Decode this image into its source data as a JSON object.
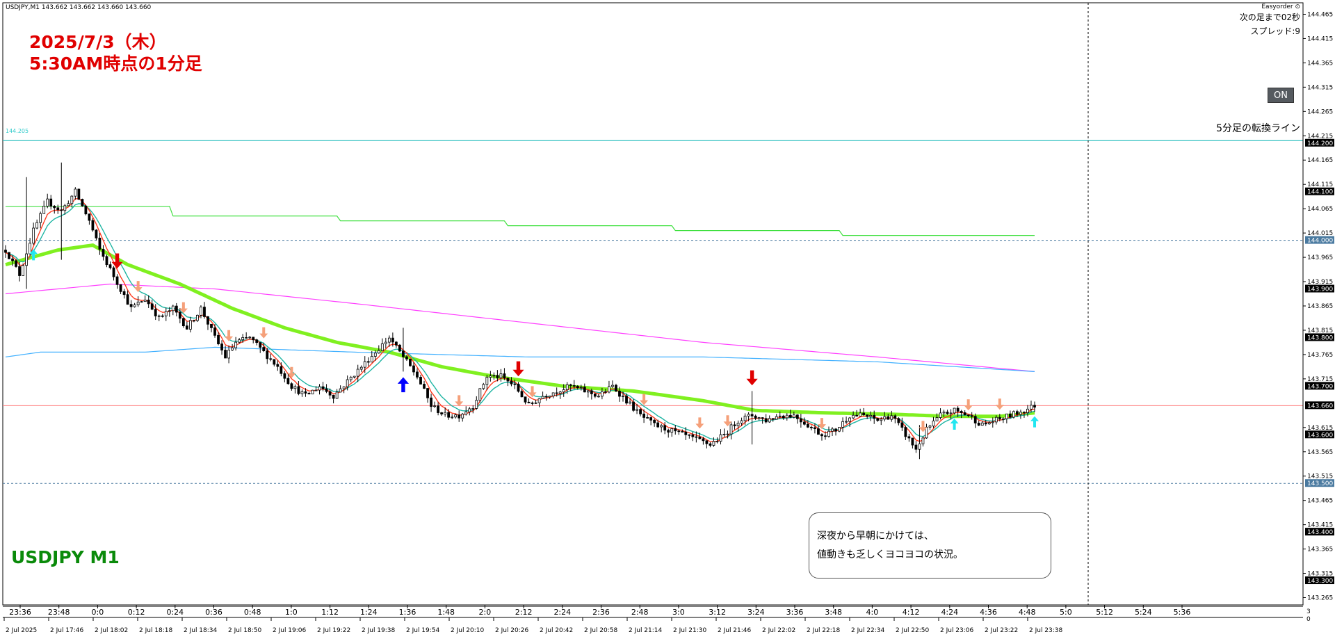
{
  "header": {
    "symbol_info": "USDJPY,M1  143.662 143.662 143.660 143.660"
  },
  "annotation": {
    "line1": "2025/7/3（木）",
    "line2": "5:30AM時点の1分足"
  },
  "corner_label": "USDJPY M1",
  "info_panel": {
    "indicator_name": "Easyorder ⊙",
    "next_bar": "次の足まで02秒",
    "spread": "スプレッド:9"
  },
  "on_button": "ON",
  "callout": {
    "line1": "深夜から早朝にかけては、",
    "line2": "値動きも乏しくヨコヨコの状況。"
  },
  "turn_line": {
    "label": "5分足の転換ライン",
    "price_label": "144.205"
  },
  "colors": {
    "background": "#ffffff",
    "candle": "#000000",
    "ema_fast": "#ff3b1f",
    "ema_mid": "#1fb5a3",
    "ema_thick": "#80f020",
    "ma_green_thin": "#40e040",
    "ma_magenta": "#ff40ff",
    "ma_lightblue": "#40b0ff",
    "bid_line": "#ff8080",
    "turn_line": "#30c0c0",
    "dotted_level": "#4a7aa0",
    "arrow_salmon": "#f5a07a",
    "arrow_red": "#e00000",
    "arrow_blue": "#0000ff",
    "arrow_cyan": "#22e6f0"
  },
  "chart_data": {
    "type": "candlestick",
    "title": "USDJPY,M1",
    "ylim": [
      143.26,
      144.48
    ],
    "y_ticks": [
      "144.465",
      "144.415",
      "144.365",
      "144.315",
      "144.265",
      "144.215",
      "144.165",
      "144.115",
      "144.065",
      "144.015",
      "143.965",
      "143.915",
      "143.865",
      "143.815",
      "143.765",
      "143.715",
      "143.615",
      "143.565",
      "143.515",
      "143.465",
      "143.415",
      "143.365",
      "143.315",
      "143.265"
    ],
    "y_highlight_ticks": [
      {
        "price": "144.200",
        "style": "black"
      },
      {
        "price": "144.100",
        "style": "black"
      },
      {
        "price": "144.000",
        "style": "blue"
      },
      {
        "price": "143.900",
        "style": "black"
      },
      {
        "price": "143.800",
        "style": "black"
      },
      {
        "price": "143.700",
        "style": "black"
      },
      {
        "price": "143.660",
        "style": "black"
      },
      {
        "price": "143.600",
        "style": "black"
      },
      {
        "price": "143.500",
        "style": "blue"
      },
      {
        "price": "143.400",
        "style": "black"
      },
      {
        "price": "143.300",
        "style": "black"
      }
    ],
    "x_time_labels": [
      "23:36",
      "23:48",
      "0:0",
      "0:12",
      "0:24",
      "0:36",
      "0:48",
      "1:0",
      "1:12",
      "1:24",
      "1:36",
      "1:48",
      "2:0",
      "2:12",
      "2:24",
      "2:36",
      "2:48",
      "3:0",
      "3:12",
      "3:24",
      "3:36",
      "3:48",
      "4:0",
      "4:12",
      "4:24",
      "4:36",
      "4:48",
      "5:0",
      "5:12",
      "5:24",
      "5:36"
    ],
    "x_date_labels": [
      "2 Jul 2025",
      "2 Jul 17:46",
      "2 Jul 18:02",
      "2 Jul 18:18",
      "2 Jul 18:34",
      "2 Jul 18:50",
      "2 Jul 19:06",
      "2 Jul 19:22",
      "2 Jul 19:38",
      "2 Jul 19:54",
      "2 Jul 20:10",
      "2 Jul 20:26",
      "2 Jul 20:42",
      "2 Jul 20:58",
      "2 Jul 21:14",
      "2 Jul 21:30",
      "2 Jul 21:46",
      "2 Jul 22:02",
      "2 Jul 22:18",
      "2 Jul 22:34",
      "2 Jul 22:50",
      "2 Jul 23:06",
      "2 Jul 23:22",
      "2 Jul 23:38"
    ],
    "bottom_right_scale": "3\n0",
    "horizontal_levels": {
      "turn_line": 144.205,
      "dotted_upper": 144.0,
      "dotted_lower": 143.5,
      "bid": 143.66
    },
    "price_path": [
      [
        0,
        143.98
      ],
      [
        4,
        143.93
      ],
      [
        8,
        144.02
      ],
      [
        12,
        144.08
      ],
      [
        16,
        144.06
      ],
      [
        20,
        144.1
      ],
      [
        24,
        144.04
      ],
      [
        27,
        143.98
      ],
      [
        30,
        143.94
      ],
      [
        33,
        143.9
      ],
      [
        36,
        143.86
      ],
      [
        40,
        143.88
      ],
      [
        44,
        143.84
      ],
      [
        48,
        143.86
      ],
      [
        52,
        143.82
      ],
      [
        56,
        143.86
      ],
      [
        60,
        143.8
      ],
      [
        63,
        143.76
      ],
      [
        66,
        143.79
      ],
      [
        70,
        143.8
      ],
      [
        74,
        143.77
      ],
      [
        78,
        143.74
      ],
      [
        82,
        143.7
      ],
      [
        86,
        143.68
      ],
      [
        90,
        143.7
      ],
      [
        94,
        143.68
      ],
      [
        98,
        143.71
      ],
      [
        102,
        143.74
      ],
      [
        106,
        143.77
      ],
      [
        110,
        143.8
      ],
      [
        114,
        143.76
      ],
      [
        118,
        143.72
      ],
      [
        122,
        143.66
      ],
      [
        126,
        143.64
      ],
      [
        130,
        143.64
      ],
      [
        134,
        143.66
      ],
      [
        138,
        143.72
      ],
      [
        142,
        143.72
      ],
      [
        146,
        143.7
      ],
      [
        150,
        143.66
      ],
      [
        154,
        143.68
      ],
      [
        158,
        143.69
      ],
      [
        162,
        143.7
      ],
      [
        166,
        143.69
      ],
      [
        170,
        143.68
      ],
      [
        174,
        143.7
      ],
      [
        178,
        143.67
      ],
      [
        182,
        143.64
      ],
      [
        186,
        143.62
      ],
      [
        190,
        143.61
      ],
      [
        194,
        143.6
      ],
      [
        198,
        143.59
      ],
      [
        202,
        143.58
      ],
      [
        206,
        143.6
      ],
      [
        210,
        143.63
      ],
      [
        214,
        143.64
      ],
      [
        218,
        143.63
      ],
      [
        222,
        143.64
      ],
      [
        226,
        143.64
      ],
      [
        230,
        143.62
      ],
      [
        234,
        143.6
      ],
      [
        238,
        143.61
      ],
      [
        242,
        143.64
      ],
      [
        246,
        143.64
      ],
      [
        250,
        143.63
      ],
      [
        254,
        143.64
      ],
      [
        258,
        143.6
      ],
      [
        261,
        143.57
      ],
      [
        264,
        143.61
      ],
      [
        268,
        143.64
      ],
      [
        272,
        143.65
      ],
      [
        276,
        143.64
      ],
      [
        280,
        143.62
      ],
      [
        284,
        143.63
      ],
      [
        288,
        143.64
      ],
      [
        292,
        143.65
      ],
      [
        295,
        143.66
      ]
    ],
    "series": [
      {
        "name": "ma_green_thin",
        "values": [
          [
            0,
            144.07
          ],
          [
            47,
            144.07
          ],
          [
            48,
            144.05
          ],
          [
            95,
            144.05
          ],
          [
            96,
            144.04
          ],
          [
            143,
            144.04
          ],
          [
            144,
            144.03
          ],
          [
            191,
            144.03
          ],
          [
            192,
            144.02
          ],
          [
            239,
            144.02
          ],
          [
            240,
            144.01
          ],
          [
            287,
            144.01
          ],
          [
            295,
            144.01
          ]
        ]
      },
      {
        "name": "ma_magenta",
        "values": [
          [
            0,
            143.89
          ],
          [
            30,
            143.91
          ],
          [
            60,
            143.9
          ],
          [
            100,
            143.87
          ],
          [
            150,
            143.83
          ],
          [
            200,
            143.79
          ],
          [
            250,
            143.76
          ],
          [
            295,
            143.73
          ]
        ]
      },
      {
        "name": "ma_lightblue",
        "values": [
          [
            0,
            143.76
          ],
          [
            10,
            143.77
          ],
          [
            40,
            143.77
          ],
          [
            60,
            143.78
          ],
          [
            100,
            143.77
          ],
          [
            150,
            143.76
          ],
          [
            200,
            143.76
          ],
          [
            250,
            143.75
          ],
          [
            295,
            143.73
          ]
        ]
      },
      {
        "name": "ema_thick",
        "values": [
          [
            0,
            143.95
          ],
          [
            15,
            143.98
          ],
          [
            25,
            143.99
          ],
          [
            35,
            143.95
          ],
          [
            50,
            143.91
          ],
          [
            65,
            143.86
          ],
          [
            80,
            143.82
          ],
          [
            95,
            143.79
          ],
          [
            110,
            143.77
          ],
          [
            125,
            143.74
          ],
          [
            140,
            143.72
          ],
          [
            160,
            143.7
          ],
          [
            180,
            143.69
          ],
          [
            200,
            143.67
          ],
          [
            215,
            143.65
          ],
          [
            235,
            143.645
          ],
          [
            255,
            143.642
          ],
          [
            270,
            143.638
          ],
          [
            285,
            143.638
          ],
          [
            295,
            143.645
          ]
        ]
      }
    ],
    "signal_arrows": [
      {
        "t": 8,
        "dir": "up",
        "color": "cyan"
      },
      {
        "t": 32,
        "dir": "down",
        "color": "red"
      },
      {
        "t": 38,
        "dir": "down",
        "color": "salmon"
      },
      {
        "t": 51,
        "dir": "down",
        "color": "salmon"
      },
      {
        "t": 64,
        "dir": "down",
        "color": "salmon"
      },
      {
        "t": 74,
        "dir": "down",
        "color": "salmon"
      },
      {
        "t": 82,
        "dir": "down",
        "color": "salmon"
      },
      {
        "t": 114,
        "dir": "up",
        "color": "blue"
      },
      {
        "t": 130,
        "dir": "down",
        "color": "salmon"
      },
      {
        "t": 147,
        "dir": "down",
        "color": "red"
      },
      {
        "t": 151,
        "dir": "down",
        "color": "salmon"
      },
      {
        "t": 183,
        "dir": "down",
        "color": "salmon"
      },
      {
        "t": 199,
        "dir": "down",
        "color": "salmon"
      },
      {
        "t": 207,
        "dir": "down",
        "color": "salmon"
      },
      {
        "t": 214,
        "dir": "down",
        "color": "red"
      },
      {
        "t": 234,
        "dir": "down",
        "color": "salmon"
      },
      {
        "t": 263,
        "dir": "down",
        "color": "salmon"
      },
      {
        "t": 272,
        "dir": "up",
        "color": "cyan"
      },
      {
        "t": 276,
        "dir": "down",
        "color": "salmon"
      },
      {
        "t": 285,
        "dir": "down",
        "color": "salmon"
      },
      {
        "t": 295,
        "dir": "up",
        "color": "cyan"
      }
    ]
  }
}
